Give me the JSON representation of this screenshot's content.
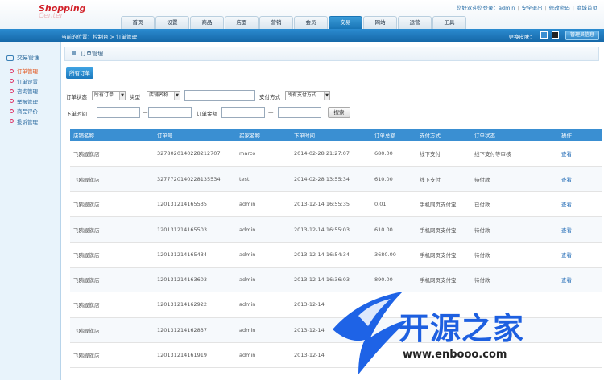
{
  "header": {
    "logo_main": "Shopping",
    "logo_sub": "Center",
    "welcome": "您好欢迎您登录：admin",
    "links": [
      "安全退出",
      "修改密码",
      "商城首页"
    ],
    "tabs": [
      "首页",
      "设置",
      "商品",
      "店面",
      "营销",
      "会员",
      "交易",
      "网站",
      "运营",
      "工具"
    ],
    "active_tab": "交易"
  },
  "navbar": {
    "breadcrumb": "当前的位置：控制台 > 订单管理",
    "skin_label": "更换皮肤：",
    "admin_button": "管理员信息"
  },
  "sidebar": {
    "title": "交易管理",
    "items": [
      "订单管理",
      "订单设置",
      "咨询管理",
      "举报管理",
      "商品评价",
      "投诉管理"
    ],
    "active": "订单管理"
  },
  "main": {
    "panel_title": "订单管理",
    "all_orders_button": "所有订单",
    "filters": {
      "status_label": "订单状态",
      "status_value": "所有订单",
      "type_label": "类型",
      "type_value": "店铺名称",
      "payment_label": "支付方式",
      "payment_value": "所有支付方式",
      "time_label": "下单时间",
      "dash": "—",
      "amount_label": "订单金额",
      "search_button": "搜索"
    },
    "table": {
      "headers": [
        "店铺名称",
        "订单号",
        "买家名称",
        "下单时间",
        "订单总额",
        "支付方式",
        "订单状态",
        "操作"
      ],
      "rows": [
        [
          "飞鸥舰旗店",
          "3278020140228212707",
          "marco",
          "2014-02-28 21:27:07",
          "680.00",
          "线下支付",
          "线下支付等审核",
          "查看"
        ],
        [
          "飞鸥舰旗店",
          "3277720140228135534",
          "test",
          "2014-02-28 13:55:34",
          "610.00",
          "线下支付",
          "待付款",
          "查看"
        ],
        [
          "飞鸥舰旗店",
          "120131214165535",
          "admin",
          "2013-12-14 16:55:35",
          "0.01",
          "手机网页支付宝",
          "已付款",
          "查看"
        ],
        [
          "飞鸥舰旗店",
          "120131214165503",
          "admin",
          "2013-12-14 16:55:03",
          "610.00",
          "手机网页支付宝",
          "待付款",
          "查看"
        ],
        [
          "飞鸥舰旗店",
          "120131214165434",
          "admin",
          "2013-12-14 16:54:34",
          "3680.00",
          "手机网页支付宝",
          "待付款",
          "查看"
        ],
        [
          "飞鸥舰旗店",
          "120131214163603",
          "admin",
          "2013-12-14 16:36:03",
          "890.00",
          "手机网页支付宝",
          "待付款",
          "查看"
        ],
        [
          "飞鸥舰旗店",
          "120131214162922",
          "admin",
          "2013-12-14",
          "",
          "",
          "",
          ""
        ],
        [
          "飞鸥舰旗店",
          "120131214162837",
          "admin",
          "2013-12-14",
          "",
          "",
          "",
          ""
        ],
        [
          "飞鸥舰旗店",
          "120131214161919",
          "admin",
          "2013-12-14",
          "",
          "",
          "",
          ""
        ]
      ]
    }
  },
  "watermark": {
    "text": "开源之家",
    "url": "www.enbooo.com"
  }
}
